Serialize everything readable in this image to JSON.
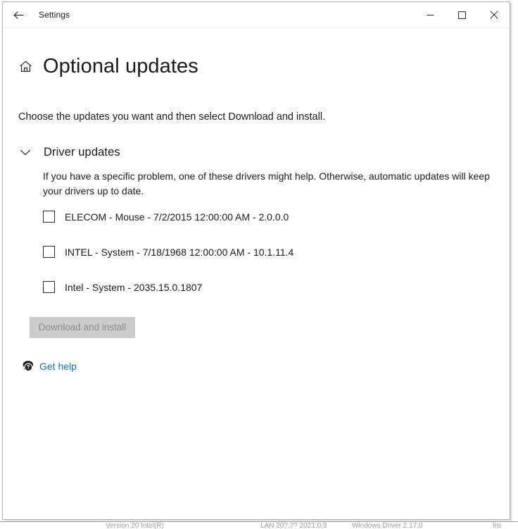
{
  "window": {
    "titlebar": {
      "back_icon": "back-arrow-icon",
      "app_title": "Settings",
      "minimize_label": "─",
      "maximize_label": "□",
      "close_label": "✕"
    }
  },
  "page": {
    "home_icon": "home-icon",
    "title": "Optional updates",
    "subtitle": "Choose the updates you want and then select Download and install."
  },
  "section": {
    "chevron_icon": "chevron-down-icon",
    "title": "Driver updates",
    "description": "If you have a specific problem, one of these drivers might help. Otherwise, automatic updates will keep your drivers up to date.",
    "items": [
      {
        "label": "ELECOM - Mouse - 7/2/2015 12:00:00 AM - 2.0.0.0",
        "checked": false
      },
      {
        "label": "INTEL - System - 7/18/1968 12:00:00 AM - 10.1.11.4",
        "checked": false
      },
      {
        "label": "Intel - System - 2035.15.0.1807",
        "checked": false
      }
    ]
  },
  "actions": {
    "download_label": "Download and install",
    "download_enabled": false,
    "help_icon": "help-bubble-icon",
    "help_label": "Get help"
  },
  "background_window": {
    "fragment_left": "Version 20   Intel(R)",
    "fragment_mid": "LAN     20?.??   2021.0.3",
    "fragment_right": "Windows Driver    2.17.0",
    "fragment_far": "lns"
  },
  "colors": {
    "link": "#1f6fc2",
    "button_disabled_bg": "#cccccc",
    "button_disabled_text": "#8c8c8c",
    "text": "#1b1b1b",
    "window_border": "#b4b4b4"
  }
}
